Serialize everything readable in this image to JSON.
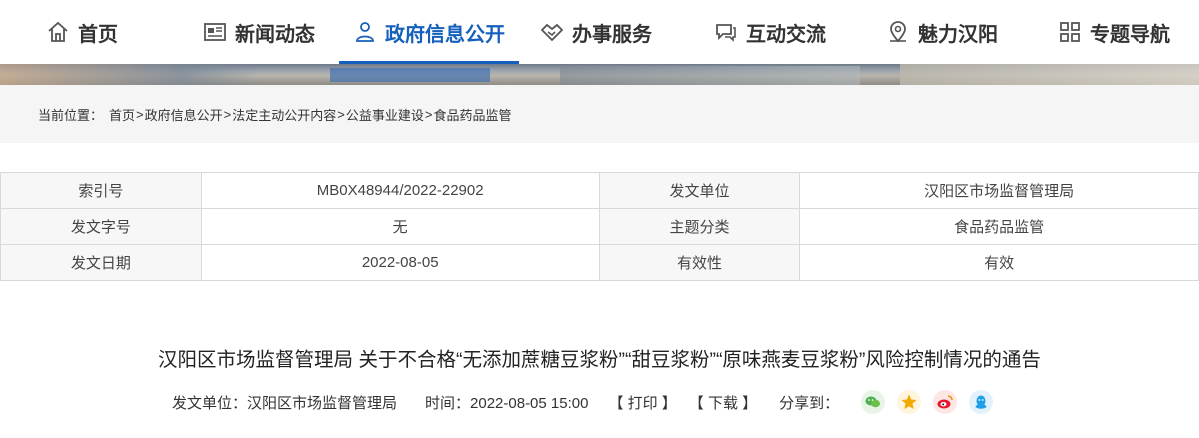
{
  "nav": {
    "items": [
      {
        "label": "首页",
        "icon": "home-icon"
      },
      {
        "label": "新闻动态",
        "icon": "news-icon"
      },
      {
        "label": "政府信息公开",
        "icon": "person-icon"
      },
      {
        "label": "办事服务",
        "icon": "handshake-icon"
      },
      {
        "label": "互动交流",
        "icon": "chat-icon"
      },
      {
        "label": "魅力汉阳",
        "icon": "location-icon"
      },
      {
        "label": "专题导航",
        "icon": "grid-icon"
      }
    ],
    "active_color": "#1560bd"
  },
  "breadcrumb": {
    "label": "当前位置：",
    "items": [
      "首页",
      "政府信息公开",
      "法定主动公开内容",
      "公益事业建设",
      "食品药品监管"
    ],
    "separator": ">"
  },
  "info_table": {
    "rows": [
      [
        "索引号",
        "MB0X48944/2022-22902",
        "发文单位",
        "汉阳区市场监督管理局"
      ],
      [
        "发文字号",
        "无",
        "主题分类",
        "食品药品监管"
      ],
      [
        "发文日期",
        "2022-08-05",
        "有效性",
        "有效"
      ]
    ]
  },
  "article": {
    "title": "汉阳区市场监督管理局 关于不合格“无添加蔗糖豆浆粉”“甜豆浆粉”“原味燕麦豆浆粉”风险控制情况的通告",
    "publisher": "发文单位：汉阳区市场监督管理局",
    "time": "时间：2022-08-05 15:00",
    "print_label": "【 打印 】",
    "download_label": "【 下载 】",
    "share_label": "分享到：",
    "share_icons": [
      {
        "name": "wechat-icon",
        "color": "#e8f5e6",
        "fg": "#4caf50"
      },
      {
        "name": "qzone-icon",
        "color": "#fff4dd",
        "fg": "#f2a900"
      },
      {
        "name": "weibo-icon",
        "color": "#fde7e4",
        "fg": "#e6162d"
      },
      {
        "name": "qq-icon",
        "color": "#e3f1fb",
        "fg": "#1e9fea"
      }
    ]
  }
}
